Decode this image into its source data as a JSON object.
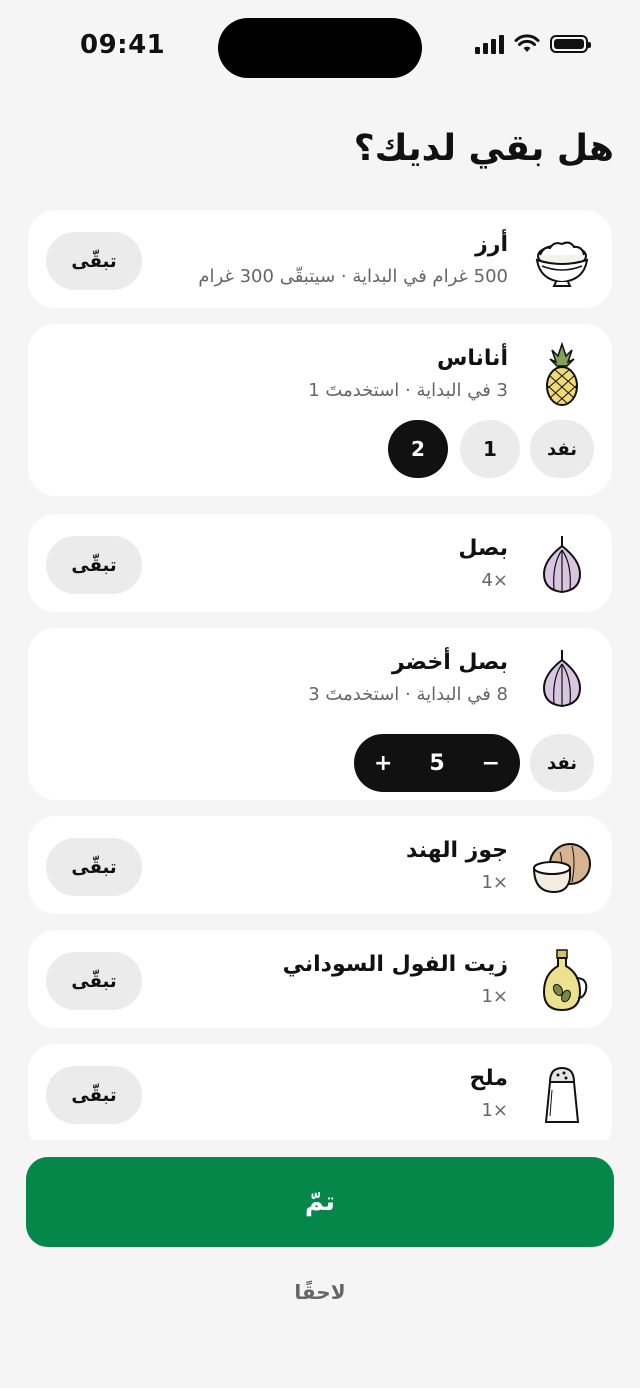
{
  "status_bar": {
    "time": "09:41"
  },
  "header": {
    "title": "هل بقي لديك؟"
  },
  "items": [
    {
      "name": "أرز",
      "detail": "500 غرام في البداية · سيتبقّى 300 غرام",
      "icon": "rice-bowl-icon",
      "action": "تبقّى"
    },
    {
      "name": "أناناس",
      "detail": "3 في البداية · استخدمتَ 1",
      "icon": "pineapple-icon",
      "ran_out": "نفد",
      "options": [
        "1",
        "2"
      ],
      "selected": "2"
    },
    {
      "name": "بصل",
      "detail": "×4",
      "icon": "onion-icon",
      "action": "تبقّى"
    },
    {
      "name": "بصل أخضر",
      "detail": "8 في البداية · استخدمتَ 3",
      "icon": "onion-icon",
      "ran_out": "نفد",
      "stepper": {
        "minus": "−",
        "value": "5",
        "plus": "+"
      }
    },
    {
      "name": "جوز الهند",
      "detail": "×1",
      "icon": "coconut-icon",
      "action": "تبقّى"
    },
    {
      "name": "زيت الفول السوداني",
      "detail": "×1",
      "icon": "oil-bottle-icon",
      "action": "تبقّى"
    },
    {
      "name": "ملح",
      "detail": "×1",
      "icon": "salt-shaker-icon",
      "action": "تبقّى"
    }
  ],
  "footer": {
    "done_label": "تمّ",
    "later_label": "لاحقًا"
  },
  "colors": {
    "primary": "#05874a",
    "background": "#f5f5f5",
    "card": "#ffffff",
    "pill": "#ebebeb",
    "selected": "#111111"
  }
}
